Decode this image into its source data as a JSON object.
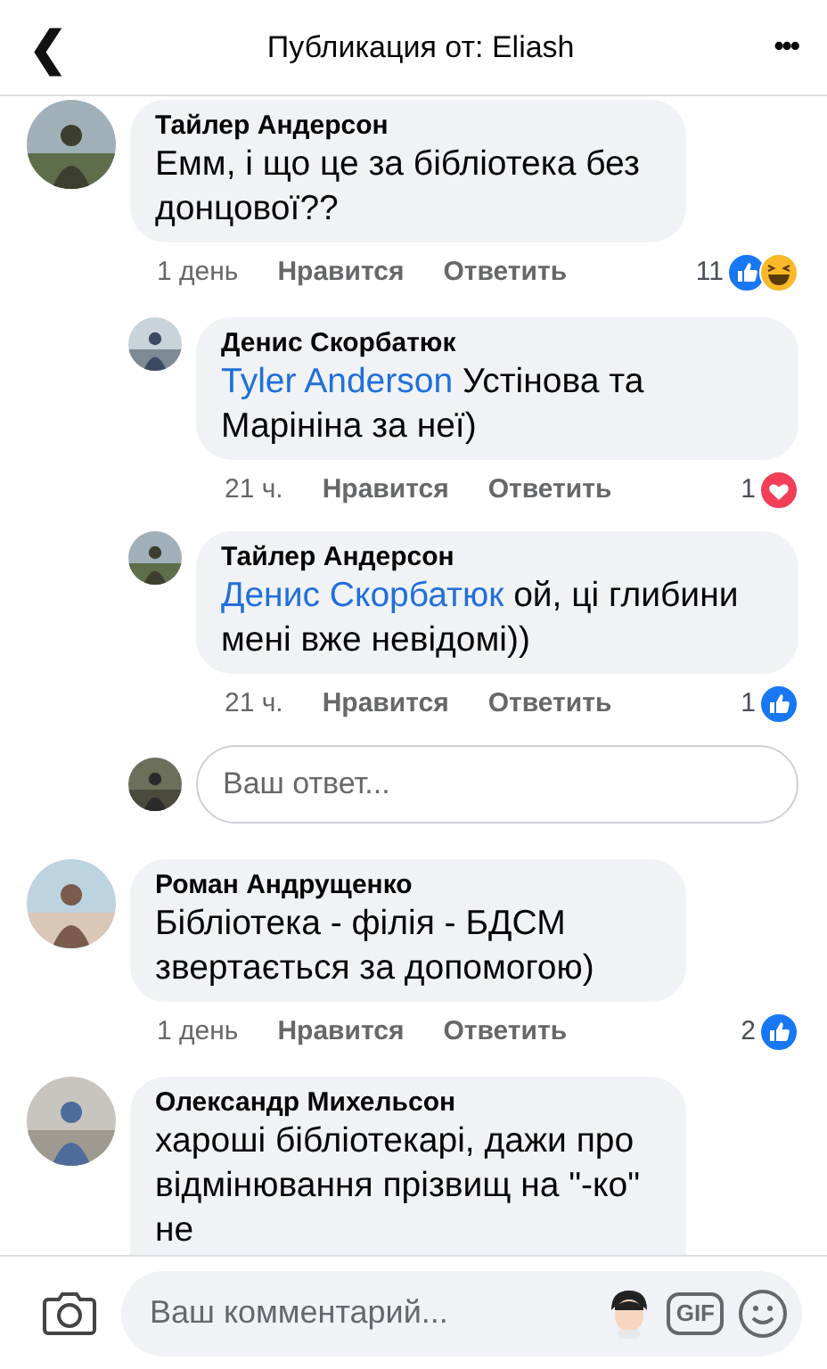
{
  "header": {
    "back": "❮",
    "title": "Публикация от: Eliash",
    "more": "•••"
  },
  "comments": [
    {
      "author": "Тайлер Андерсон",
      "text": "Емм, і що це за бібліотека без донцової??",
      "time": "1 день",
      "like": "Нравится",
      "reply": "Ответить",
      "reaction_count": "11",
      "reactions": [
        {
          "kind": "like"
        },
        {
          "kind": "haha"
        }
      ],
      "replies": [
        {
          "author": "Денис Скорбатюк",
          "mention": "Tyler Anderson",
          "text": "Устінова та Марініна за неї)",
          "time": "21 ч.",
          "like": "Нравится",
          "reply": "Ответить",
          "reaction_count": "1",
          "reactions": [
            {
              "kind": "love"
            }
          ]
        },
        {
          "author": "Тайлер Андерсон",
          "mention": "Денис Скорбатюк",
          "text": "ой, ці глибини мені вже невідомі))",
          "time": "21 ч.",
          "like": "Нравится",
          "reply": "Ответить",
          "reaction_count": "1",
          "reactions": [
            {
              "kind": "like"
            }
          ]
        }
      ],
      "reply_box": {
        "placeholder": "Ваш ответ..."
      }
    },
    {
      "author": "Роман Андрущенко",
      "text": "Бібліотека - філія - БДСМ звертається за допомогою)",
      "time": "1 день",
      "like": "Нравится",
      "reply": "Ответить",
      "reaction_count": "2",
      "reactions": [
        {
          "kind": "like"
        }
      ]
    },
    {
      "author": "Олександр Михельсон",
      "text": "хароші бібліотекарі, дажи про відмінювання прізвищ на \"-ко\" не"
    }
  ],
  "composer": {
    "placeholder": "Ваш комментарий...",
    "gif": "GIF"
  }
}
